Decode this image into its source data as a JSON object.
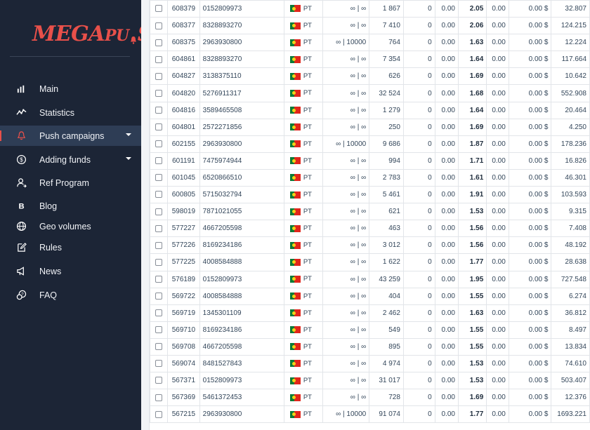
{
  "sidebar": {
    "logo": {
      "part1": "MEGA",
      "part2": "PU",
      "part3": "SH"
    },
    "items": [
      {
        "label": "Main",
        "icon": "bar-chart-icon",
        "active": false,
        "caret": false
      },
      {
        "label": "Statistics",
        "icon": "line-stats-icon",
        "active": false,
        "caret": false
      },
      {
        "label": "Push campaigns",
        "icon": "bell-icon",
        "active": true,
        "caret": true
      },
      {
        "label": "Adding funds",
        "icon": "dollar-coin-icon",
        "active": false,
        "caret": true
      },
      {
        "label": "Ref Program",
        "icon": "user-share-icon",
        "active": false,
        "caret": false
      },
      {
        "label": "Blog",
        "icon": "blog-b-icon",
        "active": false,
        "caret": false
      },
      {
        "label": "Geo volumes",
        "icon": "globe-icon",
        "active": false,
        "caret": false
      },
      {
        "label": "Rules",
        "icon": "edit-pencil-icon",
        "active": false,
        "caret": false
      },
      {
        "label": "News",
        "icon": "megaphone-icon",
        "active": false,
        "caret": false
      },
      {
        "label": "FAQ",
        "icon": "faq-chat-icon",
        "active": false,
        "caret": false
      }
    ]
  },
  "colors": {
    "sidebar_bg": "#1c2536",
    "active_bg": "#2e3d55",
    "accent": "#e8504a"
  },
  "table": {
    "rows": [
      {
        "id": "608379",
        "source": "0152809973",
        "geo": "PT",
        "cap": "∞ | ∞",
        "volume": "1 867",
        "n1": "0",
        "n2": "0.00",
        "bid": "2.05",
        "n3": "0.00",
        "cost": "0.00 $",
        "last": "32.807"
      },
      {
        "id": "608377",
        "source": "8328893270",
        "geo": "PT",
        "cap": "∞ | ∞",
        "volume": "7 410",
        "n1": "0",
        "n2": "0.00",
        "bid": "2.06",
        "n3": "0.00",
        "cost": "0.00 $",
        "last": "124.215"
      },
      {
        "id": "608375",
        "source": "2963930800",
        "geo": "PT",
        "cap": "∞ | 10000",
        "volume": "764",
        "n1": "0",
        "n2": "0.00",
        "bid": "1.63",
        "n3": "0.00",
        "cost": "0.00 $",
        "last": "12.224"
      },
      {
        "id": "604861",
        "source": "8328893270",
        "geo": "PT",
        "cap": "∞ | ∞",
        "volume": "7 354",
        "n1": "0",
        "n2": "0.00",
        "bid": "1.64",
        "n3": "0.00",
        "cost": "0.00 $",
        "last": "117.664"
      },
      {
        "id": "604827",
        "source": "3138375110",
        "geo": "PT",
        "cap": "∞ | ∞",
        "volume": "626",
        "n1": "0",
        "n2": "0.00",
        "bid": "1.69",
        "n3": "0.00",
        "cost": "0.00 $",
        "last": "10.642"
      },
      {
        "id": "604820",
        "source": "5276911317",
        "geo": "PT",
        "cap": "∞ | ∞",
        "volume": "32 524",
        "n1": "0",
        "n2": "0.00",
        "bid": "1.68",
        "n3": "0.00",
        "cost": "0.00 $",
        "last": "552.908"
      },
      {
        "id": "604816",
        "source": "3589465508",
        "geo": "PT",
        "cap": "∞ | ∞",
        "volume": "1 279",
        "n1": "0",
        "n2": "0.00",
        "bid": "1.64",
        "n3": "0.00",
        "cost": "0.00 $",
        "last": "20.464"
      },
      {
        "id": "604801",
        "source": "2572271856",
        "geo": "PT",
        "cap": "∞ | ∞",
        "volume": "250",
        "n1": "0",
        "n2": "0.00",
        "bid": "1.69",
        "n3": "0.00",
        "cost": "0.00 $",
        "last": "4.250"
      },
      {
        "id": "602155",
        "source": "2963930800",
        "geo": "PT",
        "cap": "∞ | 10000",
        "volume": "9 686",
        "n1": "0",
        "n2": "0.00",
        "bid": "1.87",
        "n3": "0.00",
        "cost": "0.00 $",
        "last": "178.236"
      },
      {
        "id": "601191",
        "source": "7475974944",
        "geo": "PT",
        "cap": "∞ | ∞",
        "volume": "994",
        "n1": "0",
        "n2": "0.00",
        "bid": "1.71",
        "n3": "0.00",
        "cost": "0.00 $",
        "last": "16.826"
      },
      {
        "id": "601045",
        "source": "6520866510",
        "geo": "PT",
        "cap": "∞ | ∞",
        "volume": "2 783",
        "n1": "0",
        "n2": "0.00",
        "bid": "1.61",
        "n3": "0.00",
        "cost": "0.00 $",
        "last": "46.301"
      },
      {
        "id": "600805",
        "source": "5715032794",
        "geo": "PT",
        "cap": "∞ | ∞",
        "volume": "5 461",
        "n1": "0",
        "n2": "0.00",
        "bid": "1.91",
        "n3": "0.00",
        "cost": "0.00 $",
        "last": "103.593"
      },
      {
        "id": "598019",
        "source": "7871021055",
        "geo": "PT",
        "cap": "∞ | ∞",
        "volume": "621",
        "n1": "0",
        "n2": "0.00",
        "bid": "1.53",
        "n3": "0.00",
        "cost": "0.00 $",
        "last": "9.315"
      },
      {
        "id": "577227",
        "source": "4667205598",
        "geo": "PT",
        "cap": "∞ | ∞",
        "volume": "463",
        "n1": "0",
        "n2": "0.00",
        "bid": "1.56",
        "n3": "0.00",
        "cost": "0.00 $",
        "last": "7.408"
      },
      {
        "id": "577226",
        "source": "8169234186",
        "geo": "PT",
        "cap": "∞ | ∞",
        "volume": "3 012",
        "n1": "0",
        "n2": "0.00",
        "bid": "1.56",
        "n3": "0.00",
        "cost": "0.00 $",
        "last": "48.192"
      },
      {
        "id": "577225",
        "source": "4008584888",
        "geo": "PT",
        "cap": "∞ | ∞",
        "volume": "1 622",
        "n1": "0",
        "n2": "0.00",
        "bid": "1.77",
        "n3": "0.00",
        "cost": "0.00 $",
        "last": "28.638"
      },
      {
        "id": "576189",
        "source": "0152809973",
        "geo": "PT",
        "cap": "∞ | ∞",
        "volume": "43 259",
        "n1": "0",
        "n2": "0.00",
        "bid": "1.95",
        "n3": "0.00",
        "cost": "0.00 $",
        "last": "727.548"
      },
      {
        "id": "569722",
        "source": "4008584888",
        "geo": "PT",
        "cap": "∞ | ∞",
        "volume": "404",
        "n1": "0",
        "n2": "0.00",
        "bid": "1.55",
        "n3": "0.00",
        "cost": "0.00 $",
        "last": "6.274"
      },
      {
        "id": "569719",
        "source": "1345301109",
        "geo": "PT",
        "cap": "∞ | ∞",
        "volume": "2 462",
        "n1": "0",
        "n2": "0.00",
        "bid": "1.63",
        "n3": "0.00",
        "cost": "0.00 $",
        "last": "36.812"
      },
      {
        "id": "569710",
        "source": "8169234186",
        "geo": "PT",
        "cap": "∞ | ∞",
        "volume": "549",
        "n1": "0",
        "n2": "0.00",
        "bid": "1.55",
        "n3": "0.00",
        "cost": "0.00 $",
        "last": "8.497"
      },
      {
        "id": "569708",
        "source": "4667205598",
        "geo": "PT",
        "cap": "∞ | ∞",
        "volume": "895",
        "n1": "0",
        "n2": "0.00",
        "bid": "1.55",
        "n3": "0.00",
        "cost": "0.00 $",
        "last": "13.834"
      },
      {
        "id": "569074",
        "source": "8481527843",
        "geo": "PT",
        "cap": "∞ | ∞",
        "volume": "4 974",
        "n1": "0",
        "n2": "0.00",
        "bid": "1.53",
        "n3": "0.00",
        "cost": "0.00 $",
        "last": "74.610"
      },
      {
        "id": "567371",
        "source": "0152809973",
        "geo": "PT",
        "cap": "∞ | ∞",
        "volume": "31 017",
        "n1": "0",
        "n2": "0.00",
        "bid": "1.53",
        "n3": "0.00",
        "cost": "0.00 $",
        "last": "503.407"
      },
      {
        "id": "567369",
        "source": "5461372453",
        "geo": "PT",
        "cap": "∞ | ∞",
        "volume": "728",
        "n1": "0",
        "n2": "0.00",
        "bid": "1.69",
        "n3": "0.00",
        "cost": "0.00 $",
        "last": "12.376"
      },
      {
        "id": "567215",
        "source": "2963930800",
        "geo": "PT",
        "cap": "∞ | 10000",
        "volume": "91 074",
        "n1": "0",
        "n2": "0.00",
        "bid": "1.77",
        "n3": "0.00",
        "cost": "0.00 $",
        "last": "1693.221"
      }
    ]
  }
}
